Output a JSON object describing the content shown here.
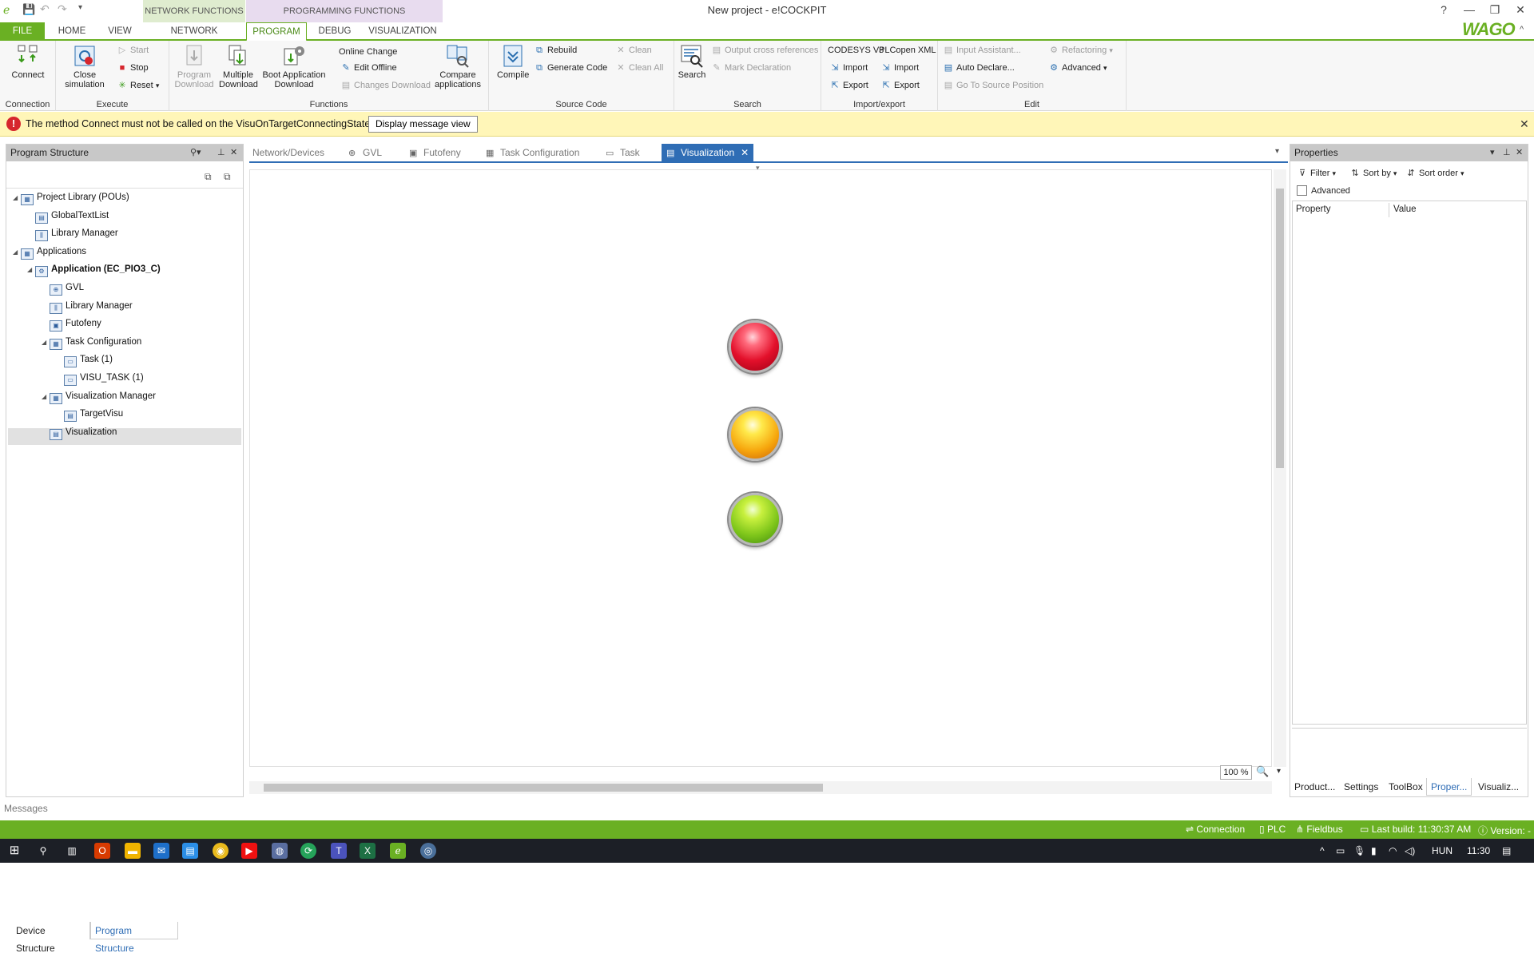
{
  "window": {
    "title": "New project - e!COCKPIT",
    "brand": "WAGO",
    "context_groups": [
      "NETWORK FUNCTIONS",
      "PROGRAMMING FUNCTIONS"
    ],
    "controls": [
      "?",
      "—",
      "❐",
      "✕",
      "^"
    ]
  },
  "ribbon_tabs": [
    "FILE",
    "HOME",
    "VIEW",
    "NETWORK",
    "PROGRAM",
    "DEBUG",
    "VISUALIZATION"
  ],
  "active_tab": "PROGRAM",
  "ribbon": {
    "connection": {
      "label": "Connection",
      "connect": "Connect"
    },
    "execute": {
      "label": "Execute",
      "close_simulation": "Close simulation",
      "start": "Start",
      "stop": "Stop",
      "reset": "Reset"
    },
    "functions": {
      "label": "Functions",
      "program_download": "Program Download",
      "multiple_download": "Multiple Download",
      "boot_application_download": "Boot Application Download",
      "online_change": "Online Change",
      "edit_offline": "Edit Offline",
      "changes_download": "Changes Download",
      "compare_applications": "Compare applications"
    },
    "source_code": {
      "label": "Source Code",
      "compile": "Compile",
      "rebuild": "Rebuild",
      "generate_code": "Generate Code",
      "clean": "Clean",
      "clean_all": "Clean All"
    },
    "search": {
      "label": "Search",
      "search": "Search",
      "output_cross_references": "Output cross references",
      "mark_declaration": "Mark Declaration"
    },
    "import_export": {
      "label": "Import/export",
      "codesys_v3": "CODESYS V3",
      "plcopen_xml": "PLCopen XML",
      "import": "Import",
      "export": "Export"
    },
    "edit": {
      "label": "Edit",
      "input_assistant": "Input Assistant...",
      "auto_declare": "Auto Declare...",
      "go_to_source_position": "Go To Source Position",
      "refactoring": "Refactoring",
      "advanced": "Advanced"
    }
  },
  "message_bar": {
    "text": "The method Connect must not be called on the VisuOnTargetConnectingState",
    "button": "Display message view"
  },
  "program_structure": {
    "title": "Program Structure",
    "tree": [
      {
        "label": "Project Library (POUs)",
        "level": 0,
        "expanded": true
      },
      {
        "label": "GlobalTextList",
        "level": 1
      },
      {
        "label": "Library Manager",
        "level": 1
      },
      {
        "label": "Applications",
        "level": 0,
        "expanded": true
      },
      {
        "label": "Application (EC_PIO3_C)",
        "level": 1,
        "expanded": true,
        "bold": true
      },
      {
        "label": "GVL",
        "level": 2
      },
      {
        "label": "Library Manager",
        "level": 2
      },
      {
        "label": "Futofeny",
        "level": 2
      },
      {
        "label": "Task Configuration",
        "level": 2,
        "expanded": true
      },
      {
        "label": "Task (1)",
        "level": 3
      },
      {
        "label": "VISU_TASK (1)",
        "level": 3
      },
      {
        "label": "Visualization Manager",
        "level": 2,
        "expanded": true
      },
      {
        "label": "TargetVisu",
        "level": 3
      },
      {
        "label": "Visualization",
        "level": 2,
        "selected": true
      }
    ],
    "bottom_tabs": [
      "Device Structure",
      "Program Structure"
    ]
  },
  "editor": {
    "tabs": [
      "Network/Devices",
      "GVL",
      "Futofeny",
      "Task Configuration",
      "Task",
      "Visualization"
    ],
    "active_tab": "Visualization",
    "lamps": [
      {
        "name": "red-lamp",
        "color": "#e3102b"
      },
      {
        "name": "yellow-lamp",
        "color": "#f6c20c"
      },
      {
        "name": "green-lamp",
        "color": "#7fc61b"
      }
    ],
    "zoom": "100 %"
  },
  "properties": {
    "title": "Properties",
    "filter": "Filter",
    "sort_by": "Sort by",
    "sort_order": "Sort order",
    "advanced": "Advanced",
    "col_property": "Property",
    "col_value": "Value",
    "bottom_tabs": [
      "Product...",
      "Settings",
      "ToolBox",
      "Proper...",
      "Visualiz..."
    ]
  },
  "messages_label": "Messages",
  "status_bar": {
    "connection": "Connection",
    "plc": "PLC",
    "fieldbus": "Fieldbus",
    "last_build": "Last build: 11:30:37 AM",
    "version": "Version: -"
  },
  "taskbar": {
    "language": "HUN",
    "time": "11:30"
  },
  "colors": {
    "accent": "#6ab023",
    "selection_blue": "#2f6db5",
    "warning_bg": "#fff6b8",
    "error_red": "#d6262d"
  }
}
